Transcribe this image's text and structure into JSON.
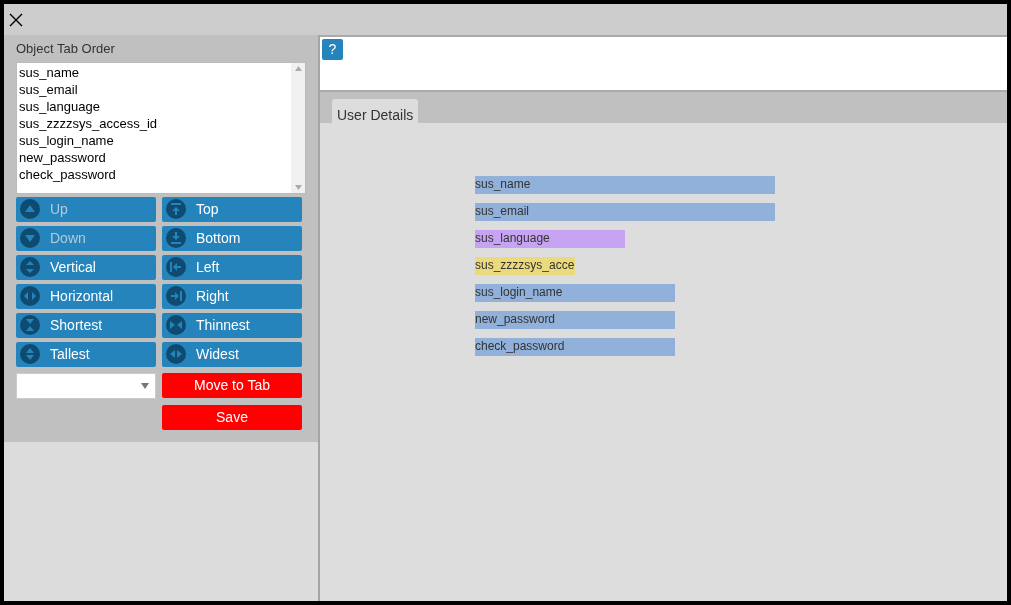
{
  "panel": {
    "title": "Object Tab Order"
  },
  "tab_order": [
    "sus_name",
    "sus_email",
    "sus_language",
    "sus_zzzzsys_access_id",
    "sus_login_name",
    "new_password",
    "check_password"
  ],
  "buttons": [
    {
      "label": "Up",
      "disabled": true
    },
    {
      "label": "Top",
      "disabled": false
    },
    {
      "label": "Down",
      "disabled": true
    },
    {
      "label": "Bottom",
      "disabled": false
    },
    {
      "label": "Vertical",
      "disabled": false
    },
    {
      "label": "Left",
      "disabled": false
    },
    {
      "label": "Horizontal",
      "disabled": false
    },
    {
      "label": "Right",
      "disabled": false
    },
    {
      "label": "Shortest",
      "disabled": false
    },
    {
      "label": "Thinnest",
      "disabled": false
    },
    {
      "label": "Tallest",
      "disabled": false
    },
    {
      "label": "Widest",
      "disabled": false
    }
  ],
  "move_button": "Move to Tab",
  "save_button": "Save",
  "help_button": "?",
  "tabs": [
    {
      "label": "User Details",
      "selected": true
    }
  ],
  "objects": [
    {
      "label": "sus_name",
      "kind": "wide",
      "color": "#91b1db"
    },
    {
      "label": "sus_email",
      "kind": "wide",
      "color": "#91b1db"
    },
    {
      "label": "sus_language",
      "kind": "medium",
      "color": "#c6a4f3"
    },
    {
      "label": "sus_zzzzsys_acce",
      "kind": "narrow",
      "color": "#ebda7c"
    },
    {
      "label": "sus_login_name",
      "kind": "long",
      "color": "#91b1db"
    },
    {
      "label": "new_password",
      "kind": "long",
      "color": "#91b1db"
    },
    {
      "label": "check_password",
      "kind": "long",
      "color": "#91b1db"
    }
  ]
}
